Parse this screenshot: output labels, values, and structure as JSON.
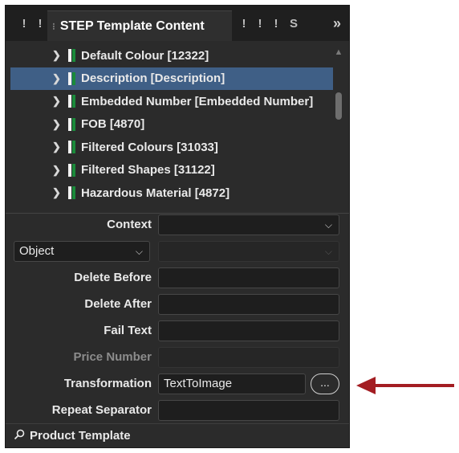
{
  "tabs": {
    "left_mini": [
      "!",
      "!"
    ],
    "active_grip": "⁝",
    "active_title": "STEP Template Content",
    "right_mini": [
      "!",
      "!",
      "!",
      "S"
    ],
    "overflow": "»"
  },
  "tree": {
    "items": [
      {
        "label": "Default Colour [12322]",
        "selected": false
      },
      {
        "label": "Description [Description]",
        "selected": true
      },
      {
        "label": "Embedded Number [Embedded Number]",
        "selected": false
      },
      {
        "label": "FOB [4870]",
        "selected": false
      },
      {
        "label": "Filtered Colours [31033]",
        "selected": false
      },
      {
        "label": "Filtered Shapes [31122]",
        "selected": false
      },
      {
        "label": "Hazardous Material [4872]",
        "selected": false
      }
    ]
  },
  "form": {
    "context_label": "Context",
    "context_value": "",
    "object_value": "Object",
    "delete_before_label": "Delete Before",
    "delete_before_value": "",
    "delete_after_label": "Delete After",
    "delete_after_value": "",
    "fail_text_label": "Fail Text",
    "fail_text_value": "",
    "price_number_label": "Price Number",
    "price_number_value": "",
    "transformation_label": "Transformation",
    "transformation_value": "TextToImage",
    "ellipsis_label": "...",
    "repeat_separator_label": "Repeat Separator",
    "repeat_separator_value": ""
  },
  "footer": {
    "label": "Product Template",
    "icon": "search-icon"
  },
  "colors": {
    "panel_bg": "#2b2b2b",
    "selection": "#3f5f86",
    "annotation_arrow": "#a31d22"
  }
}
